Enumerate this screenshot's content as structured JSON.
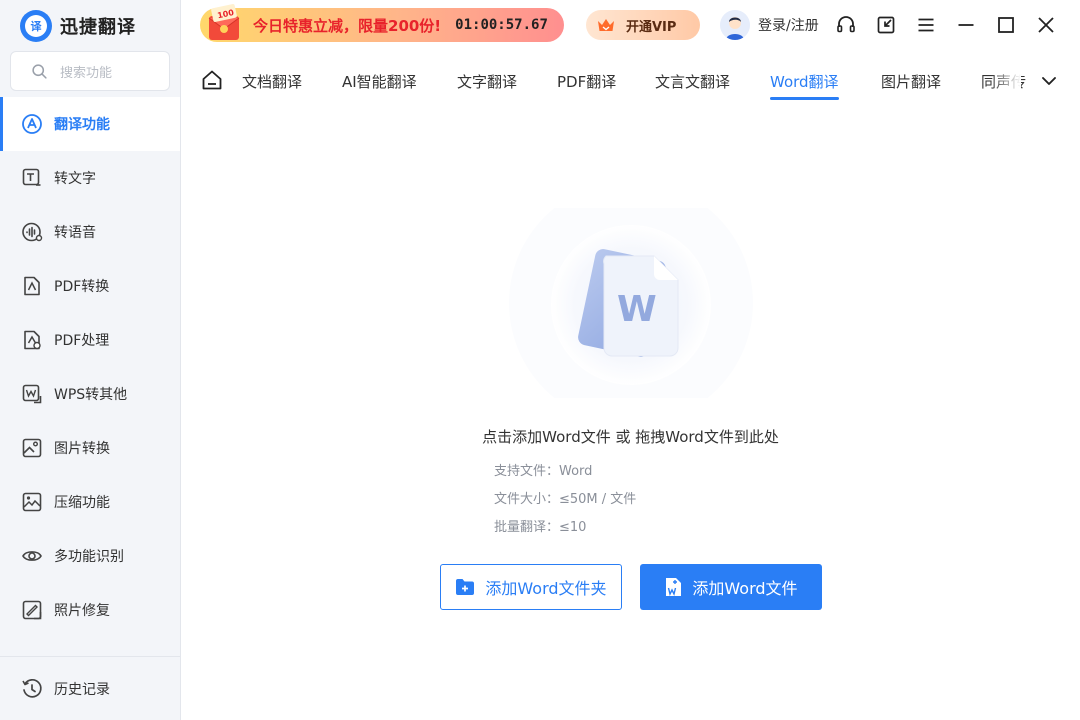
{
  "app": {
    "name": "迅捷翻译",
    "logo_glyph": "译"
  },
  "search": {
    "placeholder": "搜索功能"
  },
  "sidebar": {
    "items": [
      {
        "label": "翻译功能",
        "icon": "translate-icon",
        "active": true
      },
      {
        "label": "转文字",
        "icon": "text-convert-icon"
      },
      {
        "label": "转语音",
        "icon": "voice-icon"
      },
      {
        "label": "PDF转换",
        "icon": "pdf-convert-icon"
      },
      {
        "label": "PDF处理",
        "icon": "pdf-process-icon"
      },
      {
        "label": "WPS转其他",
        "icon": "wps-icon"
      },
      {
        "label": "图片转换",
        "icon": "image-convert-icon"
      },
      {
        "label": "压缩功能",
        "icon": "compress-icon"
      },
      {
        "label": "多功能识别",
        "icon": "recognize-icon"
      },
      {
        "label": "照片修复",
        "icon": "photo-repair-icon"
      }
    ],
    "history_label": "历史记录"
  },
  "header": {
    "promo_badge": "100",
    "promo_text": "今日特惠立减，限量200份!",
    "countdown": "01:00:57.67",
    "vip_label": "开通VIP",
    "login_label": "登录/注册"
  },
  "tabs": [
    {
      "label": "文档翻译"
    },
    {
      "label": "AI智能翻译"
    },
    {
      "label": "文字翻译"
    },
    {
      "label": "PDF翻译"
    },
    {
      "label": "文言文翻译"
    },
    {
      "label": "Word翻译",
      "active": true
    },
    {
      "label": "图片翻译"
    },
    {
      "label": "同声传"
    }
  ],
  "main": {
    "drop_title": "点击添加Word文件 或 拖拽Word文件到此处",
    "supported_files": "支持文件：Word",
    "file_size": "文件大小：≤50M / 文件",
    "batch_limit": "批量翻译：≤10",
    "add_folder_label": "添加Word文件夹",
    "add_file_label": "添加Word文件",
    "doc_letter": "W"
  },
  "colors": {
    "accent": "#2a7ef5",
    "promo_red": "#e8222b"
  }
}
